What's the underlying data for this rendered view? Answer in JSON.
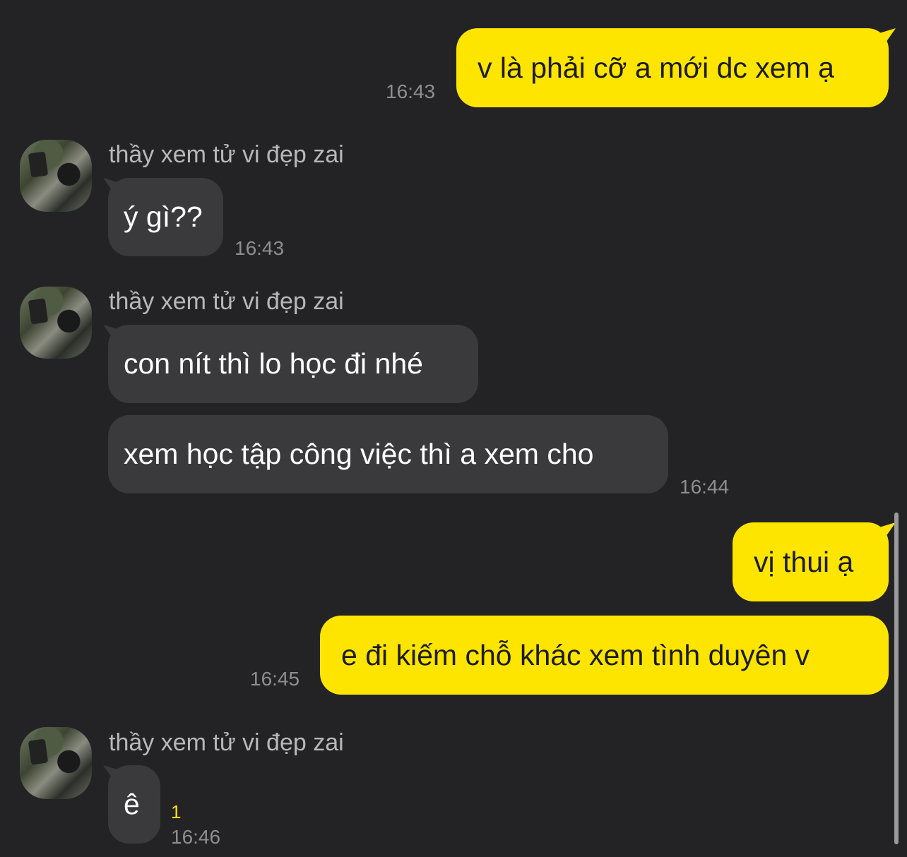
{
  "contact": {
    "name": "thầy xem tử vi đẹp zai"
  },
  "colors": {
    "sent_bubble": "#FEE500",
    "received_bubble": "#3a3a3c",
    "background": "#232325",
    "unread": "#FEE500"
  },
  "messages": [
    {
      "side": "sent",
      "text": "v là phải cỡ a mới dc xem ạ",
      "time": "16:43"
    },
    {
      "side": "received",
      "text": "ý gì??",
      "time": "16:43"
    },
    {
      "side": "received",
      "text": "con nít thì lo học đi nhé"
    },
    {
      "side": "received",
      "text": "xem học tập công việc thì a xem cho",
      "time": "16:44"
    },
    {
      "side": "sent",
      "text": "vị thui ạ"
    },
    {
      "side": "sent",
      "text": "e đi kiếm chỗ khác xem tình duyên v",
      "time": "16:45"
    },
    {
      "side": "received",
      "text": "ê",
      "time": "16:46",
      "unread_count": "1"
    }
  ]
}
